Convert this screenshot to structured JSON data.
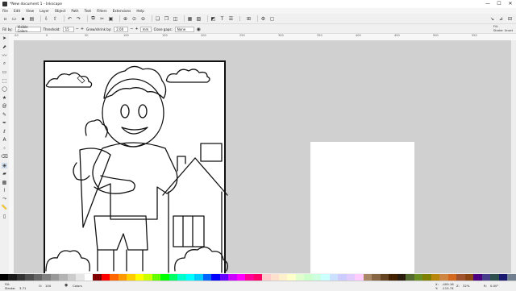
{
  "window": {
    "title": "*New document 1 - Inkscape",
    "controls": [
      "—",
      "☐",
      "✕"
    ]
  },
  "menu": [
    "File",
    "Edit",
    "View",
    "Layer",
    "Object",
    "Path",
    "Text",
    "Filters",
    "Extensions",
    "Help"
  ],
  "controls": {
    "fill_by_label": "Fill by:",
    "fill_by_value": "Visible Colors",
    "threshold_label": "Threshold:",
    "threshold_value": "15",
    "grow_label": "Grow/shrink by:",
    "grow_value": "2.00",
    "unit": "mm",
    "close_gaps_label": "Close gaps:",
    "close_gaps_value": "None"
  },
  "fill_stroke_panel": {
    "fill_label": "Fill:",
    "stroke_label": "Stroke:",
    "stroke_value": "Unset"
  },
  "ruler_ticks": [
    "-50",
    "0",
    "50",
    "100",
    "150",
    "200",
    "250",
    "300",
    "350",
    "400",
    "450",
    "500",
    "550"
  ],
  "status": {
    "fill_label": "Fill:",
    "stroke_label": "Stroke:",
    "opacity_label": "O:",
    "opacity_value": "100",
    "layer_value": "Colors",
    "stroke_width": "3.71",
    "x_label": "X:",
    "x_value": "-409.16",
    "y_label": "Y:",
    "y_value": "-115.74",
    "zoom_label": "Z:",
    "zoom_value": "32%",
    "rotation_label": "R:",
    "rotation_value": "0.00°"
  },
  "colors": {
    "ui_bg": "#f0f0f0",
    "canvas_bg": "#d0d0d0",
    "page_bg": "#ffffff",
    "drawing_stroke": "#111111",
    "active_tool": "#cfdcec"
  },
  "palette": [
    "#000000",
    "#1a1a1a",
    "#333333",
    "#4d4d4d",
    "#666666",
    "#808080",
    "#999999",
    "#b3b3b3",
    "#cccccc",
    "#e6e6e6",
    "#ffffff",
    "#800000",
    "#ff0000",
    "#ff6600",
    "#ff9900",
    "#ffcc00",
    "#ffff00",
    "#ccff00",
    "#66ff00",
    "#00ff00",
    "#00ff66",
    "#00ffcc",
    "#00ffff",
    "#00ccff",
    "#0066ff",
    "#0000ff",
    "#6600ff",
    "#cc00ff",
    "#ff00ff",
    "#ff0099",
    "#ff0066",
    "#ffcccc",
    "#ffe0cc",
    "#fff0cc",
    "#ffffcc",
    "#e0ffcc",
    "#ccffcc",
    "#ccffe0",
    "#ccffff",
    "#cce0ff",
    "#ccccff",
    "#e0ccff",
    "#ffccff",
    "#aa8866",
    "#886644",
    "#664422",
    "#442200",
    "#2b1d0e",
    "#556b2f",
    "#6b8e23",
    "#808000",
    "#b8860b",
    "#cd853f",
    "#d2691e",
    "#a0522d",
    "#8b4513",
    "#4b0082",
    "#483d8b",
    "#2f4f4f",
    "#191970",
    "#708090"
  ]
}
